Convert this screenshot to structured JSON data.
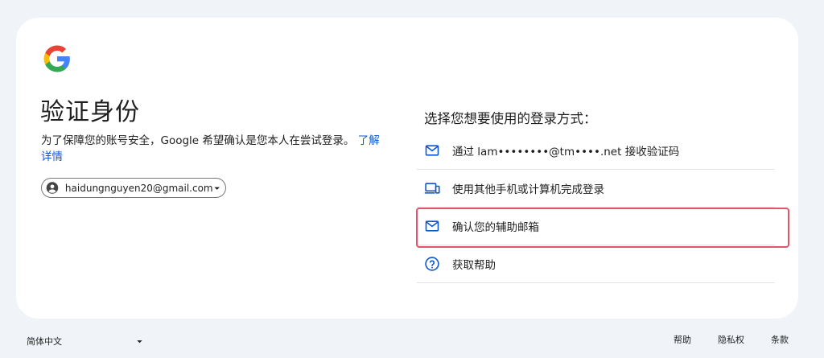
{
  "header": {
    "logo": "google-g-logo",
    "title": "验证身份",
    "description": "为了保障您的账号安全，Google 希望确认是您本人在尝试登录。",
    "learn_more": "了解详情"
  },
  "account": {
    "email": "haidungnguyen20@gmail.com",
    "avatar_icon": "account-circle-icon"
  },
  "methods": {
    "heading": "选择您想要使用的登录方式：",
    "options": [
      {
        "icon": "mail-icon",
        "label": "通过 lam••••••••@tm••••.net 接收验证码"
      },
      {
        "icon": "devices-icon",
        "label": "使用其他手机或计算机完成登录"
      },
      {
        "icon": "mail-icon",
        "label": "确认您的辅助邮箱"
      },
      {
        "icon": "help-circle-icon",
        "label": "获取帮助"
      }
    ]
  },
  "footer": {
    "language": "简体中文",
    "links": [
      "帮助",
      "隐私权",
      "条款"
    ]
  },
  "colors": {
    "accent": "#0b57d0",
    "highlight": "#e0566a",
    "background": "#f0f4f9"
  }
}
